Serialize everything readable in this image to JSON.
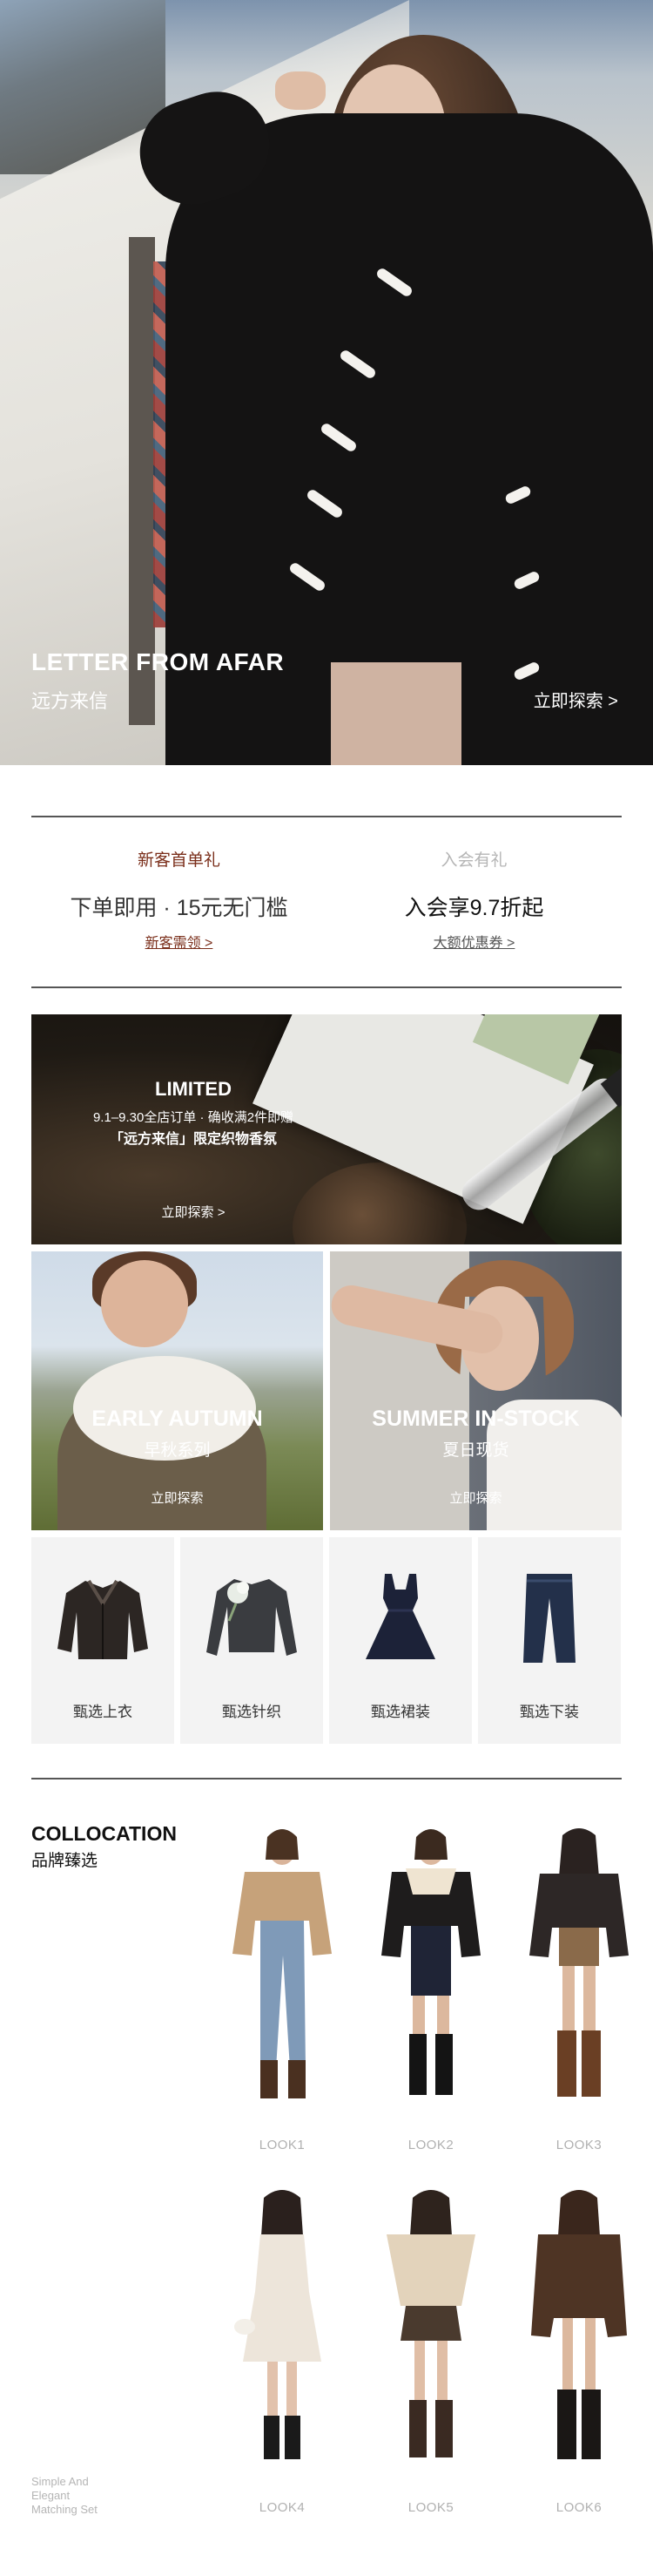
{
  "hero": {
    "title": "LETTER FROM AFAR",
    "subtitle": "远方来信",
    "explore": "立即探索 >"
  },
  "benefits": [
    {
      "label": "新客首单礼",
      "main": "下单即用 · 15元无门槛",
      "link": "新客需领 >"
    },
    {
      "label": "入会有礼",
      "main": "入会享9.7折起",
      "link": "大额优惠券 >"
    }
  ],
  "limited": {
    "title": "LIMITED",
    "line1": "9.1–9.30全店订单 · 确收满2件即赠",
    "line2": "「远方来信」限定织物香氛",
    "explore": "立即探索 >"
  },
  "seasons": [
    {
      "title": "EARLY AUTUMN",
      "subtitle": "早秋系列",
      "explore": "立即探索"
    },
    {
      "title": "SUMMER IN-STOCK",
      "subtitle": "夏日现货",
      "explore": "立即探索"
    }
  ],
  "categories": [
    {
      "label": "甄选上衣",
      "icon": "jacket-icon"
    },
    {
      "label": "甄选针织",
      "icon": "knit-top-icon"
    },
    {
      "label": "甄选裙装",
      "icon": "dress-icon"
    },
    {
      "label": "甄选下装",
      "icon": "jeans-icon"
    }
  ],
  "collocation": {
    "title": "COLLOCATION",
    "subtitle": "品牌臻选",
    "looks": [
      "LOOK1",
      "LOOK2",
      "LOOK3",
      "LOOK4",
      "LOOK5",
      "LOOK6"
    ],
    "tagline": [
      "Simple And",
      "Elegant",
      "Matching Set"
    ]
  },
  "colors": {
    "accent": "#7a2e1a",
    "rule": "#555555",
    "tile_bg": "#f3f3f3",
    "muted": "#b0b0b0"
  }
}
